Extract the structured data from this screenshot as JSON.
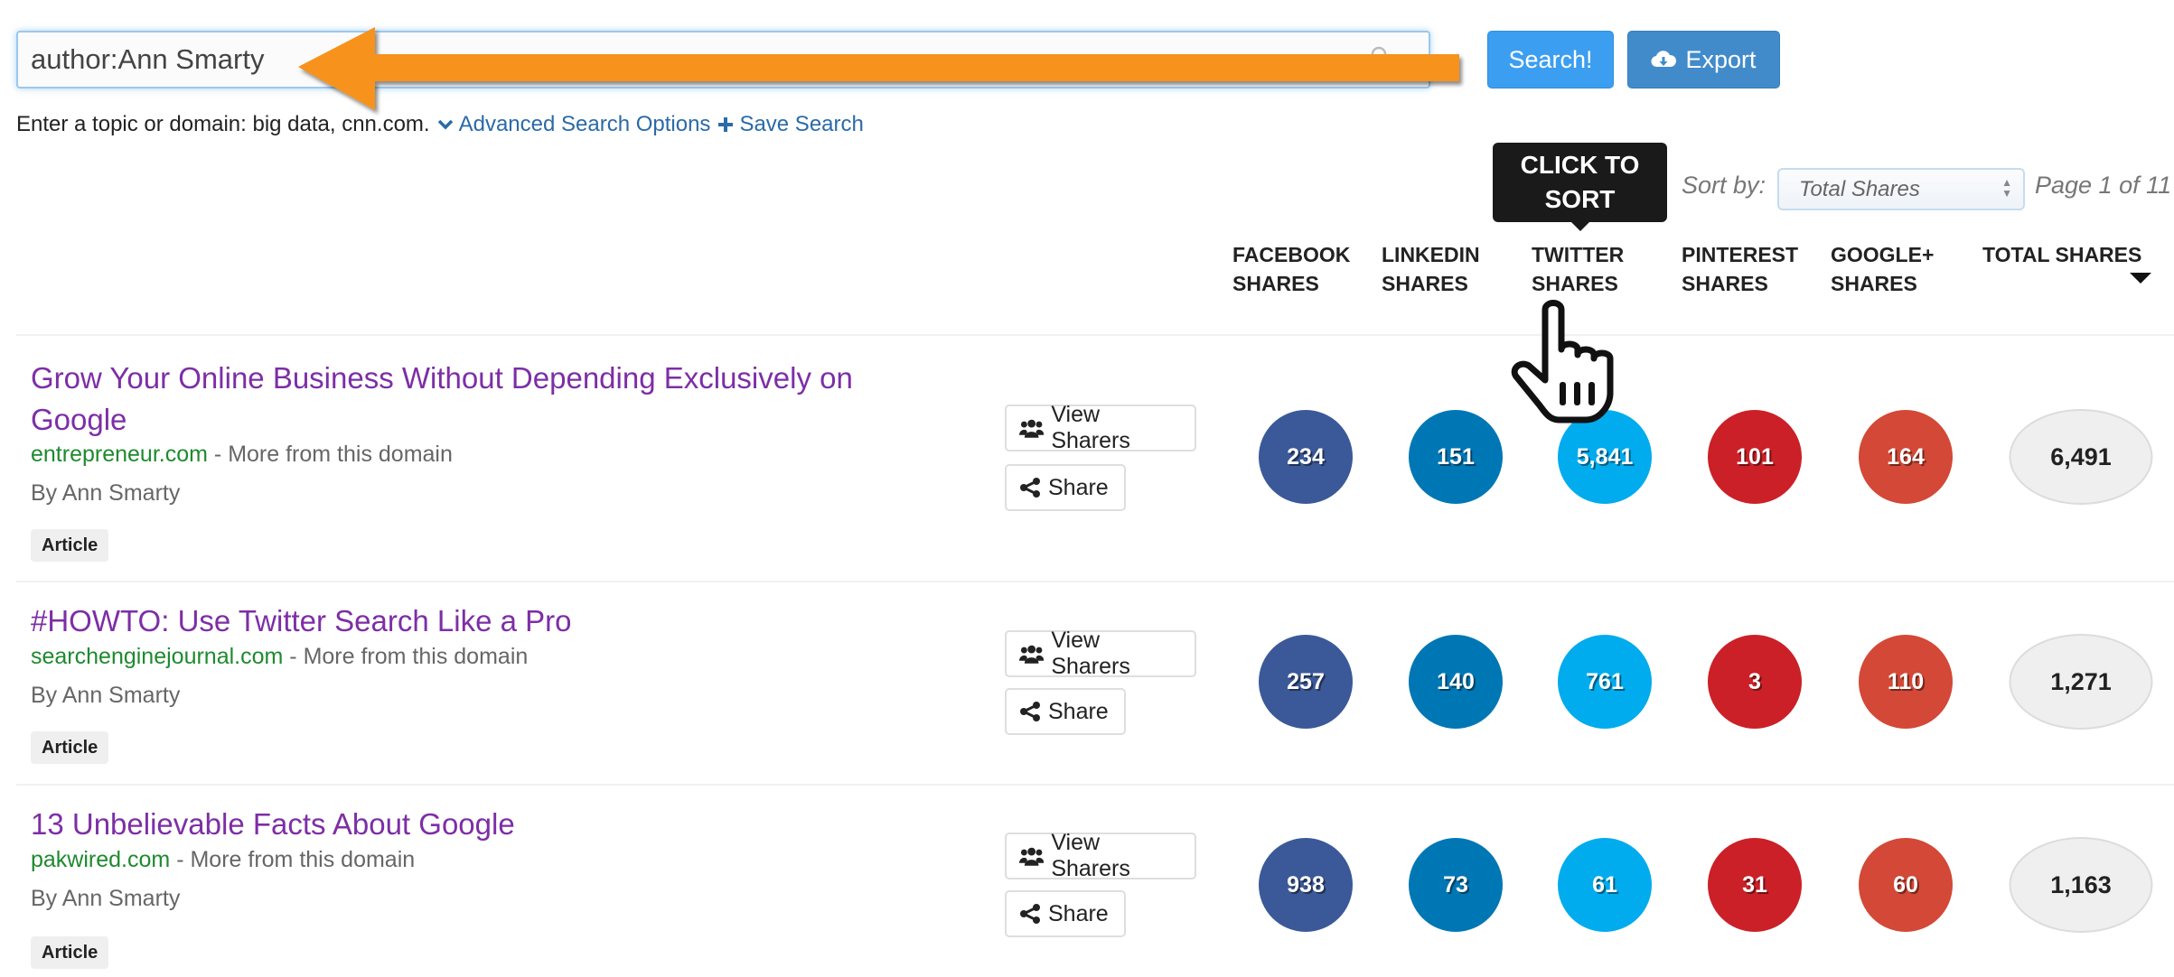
{
  "search": {
    "value": "author:Ann Smarty",
    "search_button": "Search!",
    "export_button": "Export",
    "helper_text": "Enter a topic or domain: big data, cnn.com.",
    "advanced_link": "Advanced Search Options",
    "save_link": "Save Search"
  },
  "annotation": {
    "tooltip_line1": "CLICK TO",
    "tooltip_line2": "SORT",
    "arrow_color": "#f7921e"
  },
  "sort": {
    "label": "Sort by:",
    "selected": "Total Shares",
    "page_info": "Page 1 of 11"
  },
  "columns": [
    {
      "line1": "FACEBOOK",
      "line2": "SHARES",
      "color": "#3b5998"
    },
    {
      "line1": "LINKEDIN",
      "line2": "SHARES",
      "color": "#0077b5"
    },
    {
      "line1": "TWITTER",
      "line2": "SHARES",
      "color": "#00aced"
    },
    {
      "line1": "PINTEREST",
      "line2": "SHARES",
      "color": "#cb2027"
    },
    {
      "line1": "GOOGLE+",
      "line2": "SHARES",
      "color": "#d34836"
    },
    {
      "line1": "TOTAL SHARES",
      "line2": ""
    }
  ],
  "row_actions": {
    "view_sharers": "View Sharers",
    "share": "Share",
    "more_from_domain": "More from this domain",
    "separator": "-"
  },
  "results": [
    {
      "title": "Grow Your Online Business Without Depending Exclusively on Google",
      "domain": "entrepreneur.com",
      "author": "By Ann Smarty",
      "type": "Article",
      "facebook": "234",
      "linkedin": "151",
      "twitter": "5,841",
      "pinterest": "101",
      "googleplus": "164",
      "total": "6,491"
    },
    {
      "title": "#HOWTO: Use Twitter Search Like a Pro",
      "domain": "searchenginejournal.com",
      "author": "By Ann Smarty",
      "type": "Article",
      "facebook": "257",
      "linkedin": "140",
      "twitter": "761",
      "pinterest": "3",
      "googleplus": "110",
      "total": "1,271"
    },
    {
      "title": "13 Unbelievable Facts About Google",
      "domain": "pakwired.com",
      "author": "By Ann Smarty",
      "type": "Article",
      "facebook": "938",
      "linkedin": "73",
      "twitter": "61",
      "pinterest": "31",
      "googleplus": "60",
      "total": "1,163"
    }
  ]
}
